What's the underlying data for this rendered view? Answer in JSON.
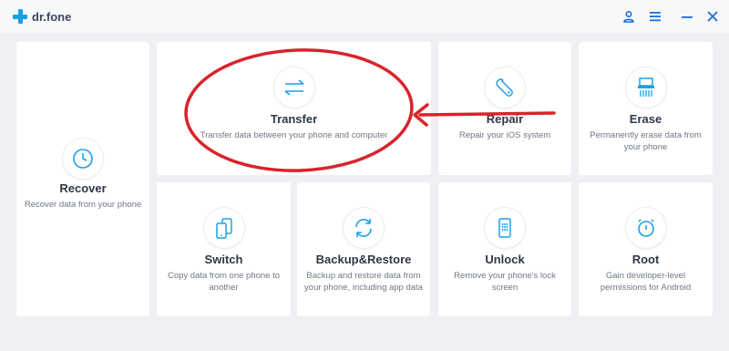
{
  "app": {
    "title": "dr.fone"
  },
  "window_controls": {
    "account": "account-icon",
    "menu": "menu-icon",
    "minimize": "minimize-icon",
    "close": "close-icon"
  },
  "cards": {
    "recover": {
      "title": "Recover",
      "desc": "Recover data from your phone",
      "icon": "clock-icon"
    },
    "transfer": {
      "title": "Transfer",
      "desc": "Transfer data between your phone and computer",
      "icon": "arrows-icon"
    },
    "repair": {
      "title": "Repair",
      "desc": "Repair your iOS system",
      "icon": "wrench-icon"
    },
    "erase": {
      "title": "Erase",
      "desc": "Permanently erase data from your phone",
      "icon": "shredder-icon"
    },
    "switch": {
      "title": "Switch",
      "desc": "Copy data from one phone to another",
      "icon": "phones-icon"
    },
    "backup": {
      "title": "Backup&Restore",
      "desc": "Backup and restore data from your phone, including app data",
      "icon": "sync-icon"
    },
    "unlock": {
      "title": "Unlock",
      "desc": "Remove your phone's lock screen",
      "icon": "lock-grid-icon"
    },
    "root": {
      "title": "Root",
      "desc": "Gain developer-level permissions for Android",
      "icon": "timer-icon"
    }
  },
  "colors": {
    "accent": "#1ba0e8",
    "annotation": "#d9232b",
    "background": "#eef0f3"
  }
}
